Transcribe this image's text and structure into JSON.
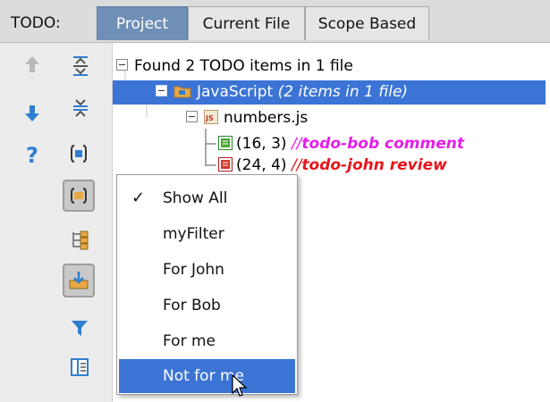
{
  "tabs": {
    "label": "TODO:",
    "items": [
      "Project",
      "Current File",
      "Scope Based"
    ],
    "active": "Project"
  },
  "toolbar": {
    "buttons": [
      {
        "name": "up-arrow-icon"
      },
      {
        "name": "expand-all-icon"
      },
      {
        "name": "down-arrow-icon"
      },
      {
        "name": "collapse-all-icon"
      },
      {
        "name": "help-icon"
      },
      {
        "name": "group-by-module-icon"
      },
      {
        "name": "group-by-directory-icon"
      },
      {
        "name": "flatten-packages-icon"
      },
      {
        "name": "autoscroll-icon"
      },
      {
        "name": "filter-icon"
      },
      {
        "name": "preview-icon"
      }
    ]
  },
  "tree": {
    "root": "Found 2 TODO items in 1 file",
    "folder": "JavaScript",
    "folder_count": "(2 items in 1 file)",
    "file": "numbers.js",
    "items": [
      {
        "pos": "(16, 3)",
        "slashes": "//",
        "text": "todo-bob comment"
      },
      {
        "pos": "(24, 4)",
        "slashes": "//",
        "text": "todo-john review"
      }
    ]
  },
  "filter_menu": {
    "items": [
      "Show All",
      "myFilter",
      "For John",
      "For Bob",
      "For me",
      "Not for me"
    ],
    "checked": "Show All",
    "highlighted": "Not for me"
  },
  "colors": {
    "selection": "#3b74d5",
    "bob": "#e41ee8",
    "john": "#e8141a",
    "icon_blue": "#2f7fd0"
  }
}
